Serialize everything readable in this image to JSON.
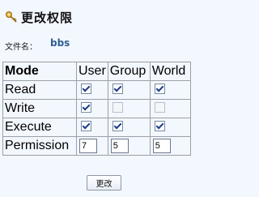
{
  "header": {
    "title": "更改权限",
    "icon": "key-icon"
  },
  "file": {
    "label": "文件名：",
    "name": "bbs"
  },
  "table": {
    "headers": [
      "Mode",
      "User",
      "Group",
      "World"
    ],
    "rows": [
      {
        "label": "Read",
        "user": true,
        "group": true,
        "world": true
      },
      {
        "label": "Write",
        "user": true,
        "group": false,
        "world": false
      },
      {
        "label": "Execute",
        "user": true,
        "group": true,
        "world": true
      }
    ],
    "permission": {
      "label": "Permission",
      "user": "7",
      "group": "5",
      "world": "5"
    }
  },
  "submit_label": "更改"
}
